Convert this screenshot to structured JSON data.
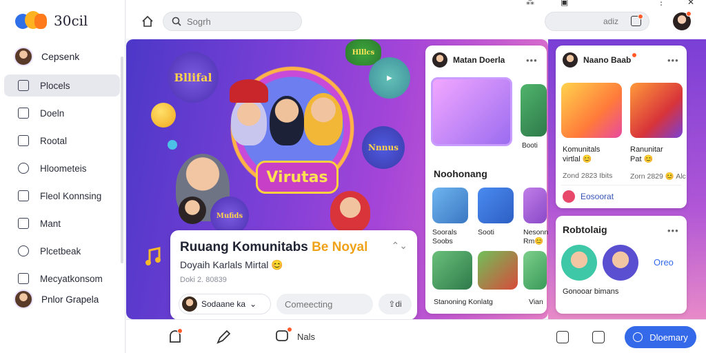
{
  "app": {
    "logo_text": "30cil"
  },
  "sidebar": {
    "profile_name": "Cepsenk",
    "items": [
      {
        "label": "Plocels",
        "icon": "doc-icon",
        "active": true
      },
      {
        "label": "Doeln",
        "icon": "book-icon",
        "active": false
      },
      {
        "label": "Rootal",
        "icon": "chat-icon",
        "active": false
      },
      {
        "label": "Hloometeis",
        "icon": "person-icon",
        "active": false
      },
      {
        "label": "Fleol Konnsing",
        "icon": "mail-icon",
        "active": false
      },
      {
        "label": "Mant",
        "icon": "inbox-icon",
        "active": false
      },
      {
        "label": "Plcetbeak",
        "icon": "search-person-icon",
        "active": false
      },
      {
        "label": "Mecyatkonsom",
        "icon": "edit-icon",
        "active": false
      }
    ],
    "bottom_profile": "Pnlor Grapela"
  },
  "header": {
    "search_placeholder": "Sogrh",
    "pill_text": "adiz",
    "window_controls": [
      "⁂",
      "▣",
      "⋮",
      "✕"
    ]
  },
  "hero": {
    "banner_text": "Virutas",
    "badge_texts": [
      "Bllifal",
      "Nnnus",
      "Mufids",
      "Hlllcs"
    ],
    "card": {
      "title_main": "Ruuang Komunitabs",
      "title_highlight": "Be Noyal",
      "subtitle": "Doyaih Karlals Mirtal 😊",
      "meta": "Doki 2. 80839",
      "more": "⌃⌄",
      "user": "Sodaane ka",
      "comment_placeholder": "Comeecting",
      "share": "di"
    }
  },
  "panel_a": {
    "header_name": "Matan Doerla",
    "more": "•••",
    "tile_caption": "Booti",
    "section_title": "Noohonang",
    "grid_labels": [
      "Soorals\nSoobs",
      "Sooti",
      "Nesonn\nRm😊"
    ],
    "row_caption": "Stanoning Konlatg",
    "row_caption_right": "Vian"
  },
  "panel_b": {
    "header_name": "Naano Baab",
    "more": "•••",
    "tiles": [
      {
        "title": "Komunitals\nvirtlal 😊",
        "meta": "Zond 2823 Ibits"
      },
      {
        "title": "Ranunitar\nPat 😊",
        "meta": "Zorn 2829 😊 Alc"
      }
    ],
    "footer_link": "Eosoorat"
  },
  "panel_c": {
    "title": "Robtolaig",
    "more": "•••",
    "link": "Oreo",
    "caption": "Gonooar bimans"
  },
  "bottombar": {
    "chat_label": "Nals",
    "discover_label": "Dloemary"
  },
  "colors": {
    "accent": "#3469ea",
    "highlight": "#f0a21b",
    "badge_dot": "#ff5a2a"
  }
}
